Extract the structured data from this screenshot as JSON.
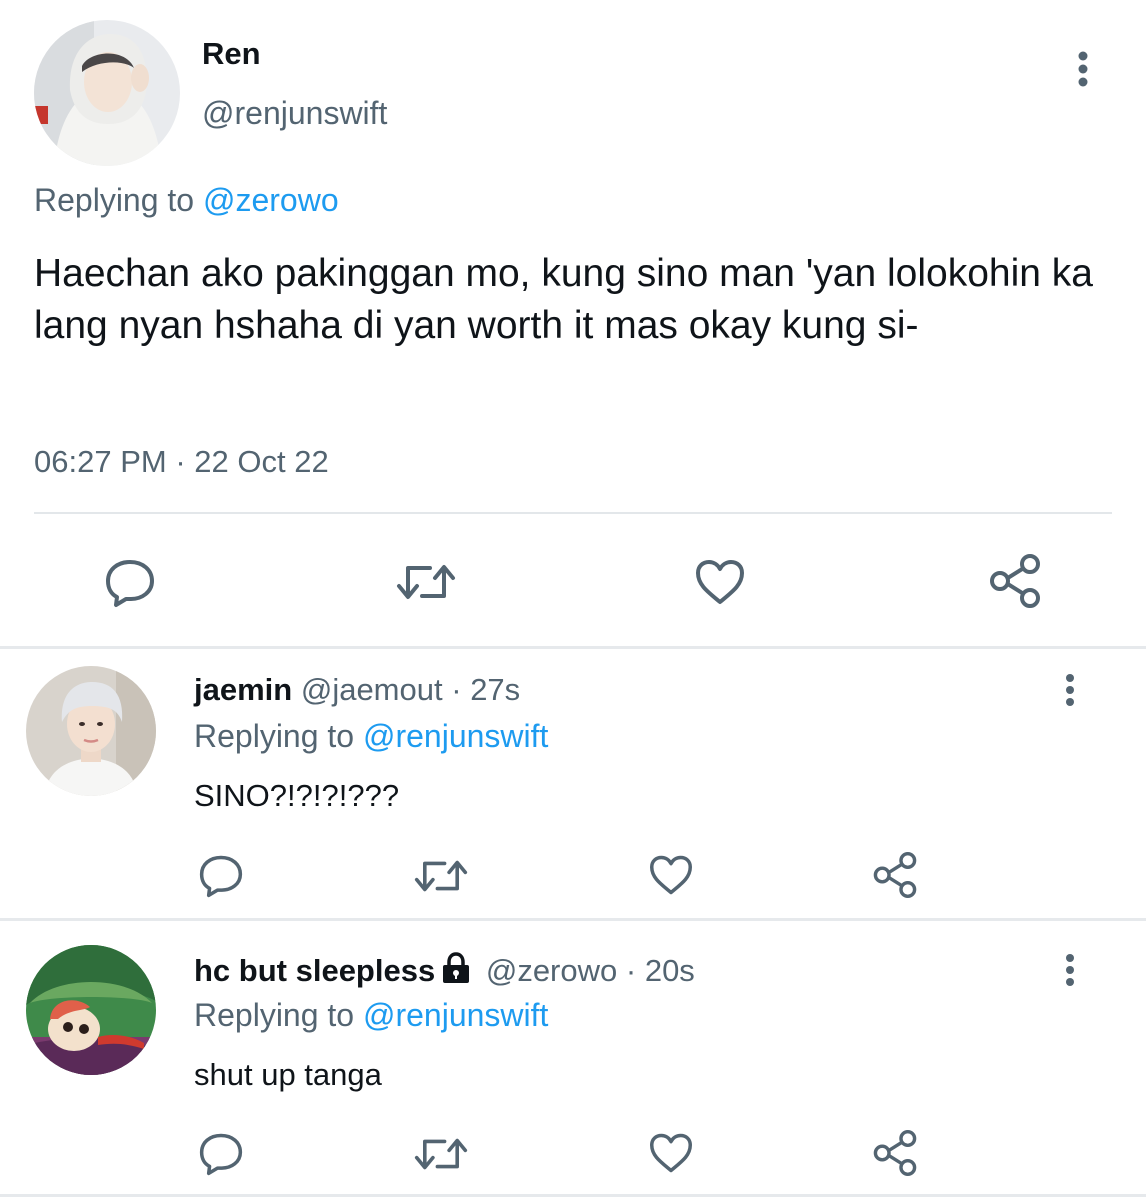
{
  "main_tweet": {
    "display_name": "Ren",
    "handle": "@renjunswift",
    "replying_label": "Replying to",
    "replying_to": "@zerowo",
    "text": "Haechan ako pakinggan mo, kung sino man 'yan lolokohin ka lang nyan hshaha di yan worth it mas okay kung si-",
    "time": "06:27 PM",
    "separator": "·",
    "date": "22 Oct 22",
    "actions": [
      "reply-icon",
      "retweet-icon",
      "like-icon",
      "share-icon"
    ]
  },
  "replies": [
    {
      "display_name": "jaemin",
      "handle": "@jaemout",
      "separator": "·",
      "age": "27s",
      "replying_label": "Replying to",
      "replying_to": "@renjunswift",
      "text": "SINO?!?!?!???",
      "protected": false
    },
    {
      "display_name": "hc but sleepless",
      "handle": "@zerowo",
      "separator": "·",
      "age": "20s",
      "replying_label": "Replying to",
      "replying_to": "@renjunswift",
      "text": "shut up tanga",
      "protected": true
    }
  ],
  "colors": {
    "text_primary": "#0f1419",
    "text_secondary": "#536471",
    "link": "#1d9bf0",
    "icon": "#536471",
    "divider": "#e3e7ea"
  }
}
